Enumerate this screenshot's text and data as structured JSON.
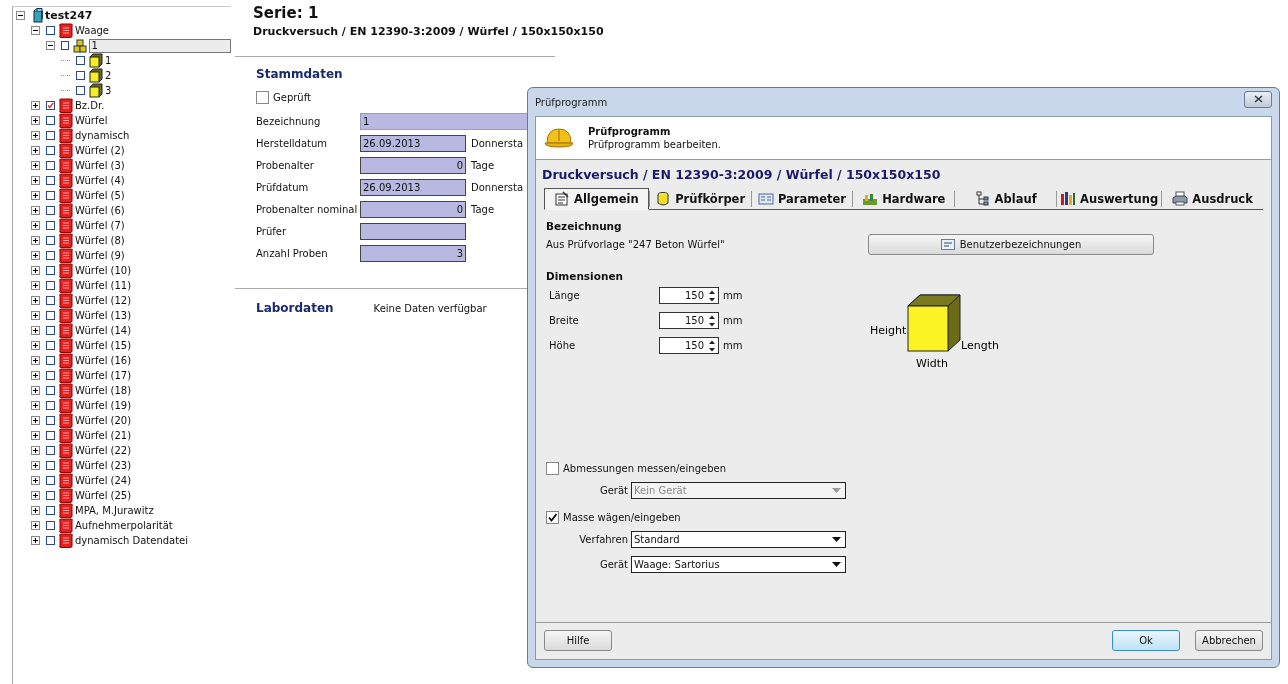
{
  "tree": [
    {
      "label": "test247",
      "kind": "database",
      "expanded": true,
      "children": [
        {
          "label": "Waage",
          "kind": "series",
          "checked": false,
          "expanded": true,
          "children": [
            {
              "label": "1",
              "kind": "group",
              "checked": false,
              "expanded": true,
              "selected": true,
              "children": [
                {
                  "label": "1",
                  "kind": "specimen",
                  "checked": false
                },
                {
                  "label": "2",
                  "kind": "specimen",
                  "checked": false
                },
                {
                  "label": "3",
                  "kind": "specimen",
                  "checked": false
                }
              ]
            }
          ]
        },
        {
          "label": "Bz.Dr.",
          "kind": "series",
          "checked": true,
          "expanded": false
        },
        {
          "label": "Würfel",
          "kind": "series",
          "checked": false,
          "expanded": false
        },
        {
          "label": "dynamisch",
          "kind": "series",
          "checked": false,
          "expanded": false
        },
        {
          "label": "Würfel (2)",
          "kind": "series",
          "checked": false,
          "expanded": false
        },
        {
          "label": "Würfel (3)",
          "kind": "series",
          "checked": false,
          "expanded": false
        },
        {
          "label": "Würfel (4)",
          "kind": "series",
          "checked": false,
          "expanded": false
        },
        {
          "label": "Würfel (5)",
          "kind": "series",
          "checked": false,
          "expanded": false
        },
        {
          "label": "Würfel (6)",
          "kind": "series",
          "checked": false,
          "expanded": false
        },
        {
          "label": "Würfel (7)",
          "kind": "series",
          "checked": false,
          "expanded": false
        },
        {
          "label": "Würfel (8)",
          "kind": "series",
          "checked": false,
          "expanded": false
        },
        {
          "label": "Würfel (9)",
          "kind": "series",
          "checked": false,
          "expanded": false
        },
        {
          "label": "Würfel (10)",
          "kind": "series",
          "checked": false,
          "expanded": false
        },
        {
          "label": "Würfel (11)",
          "kind": "series",
          "checked": false,
          "expanded": false
        },
        {
          "label": "Würfel (12)",
          "kind": "series",
          "checked": false,
          "expanded": false
        },
        {
          "label": "Würfel (13)",
          "kind": "series",
          "checked": false,
          "expanded": false
        },
        {
          "label": "Würfel (14)",
          "kind": "series",
          "checked": false,
          "expanded": false
        },
        {
          "label": "Würfel (15)",
          "kind": "series",
          "checked": false,
          "expanded": false
        },
        {
          "label": "Würfel (16)",
          "kind": "series",
          "checked": false,
          "expanded": false
        },
        {
          "label": "Würfel (17)",
          "kind": "series",
          "checked": false,
          "expanded": false
        },
        {
          "label": "Würfel (18)",
          "kind": "series",
          "checked": false,
          "expanded": false
        },
        {
          "label": "Würfel (19)",
          "kind": "series",
          "checked": false,
          "expanded": false
        },
        {
          "label": "Würfel (20)",
          "kind": "series",
          "checked": false,
          "expanded": false
        },
        {
          "label": "Würfel (21)",
          "kind": "series",
          "checked": false,
          "expanded": false
        },
        {
          "label": "Würfel (22)",
          "kind": "series",
          "checked": false,
          "expanded": false
        },
        {
          "label": "Würfel (23)",
          "kind": "series",
          "checked": false,
          "expanded": false
        },
        {
          "label": "Würfel (24)",
          "kind": "series",
          "checked": false,
          "expanded": false
        },
        {
          "label": "Würfel (25)",
          "kind": "series",
          "checked": false,
          "expanded": false
        },
        {
          "label": "MPA, M.Jurawitz",
          "kind": "series",
          "checked": false,
          "expanded": false
        },
        {
          "label": "Aufnehmerpolarität",
          "kind": "series",
          "checked": false,
          "expanded": false
        },
        {
          "label": "dynamisch Datendatei",
          "kind": "series",
          "checked": false,
          "expanded": false
        }
      ]
    }
  ],
  "series": {
    "title": "Serie:  1",
    "subtitle": "Druckversuch / EN 12390-3:2009 / Würfel / 150x150x150",
    "master_heading": "Stammdaten",
    "checked_label": "Geprüft",
    "checked": false,
    "fields": [
      {
        "label": "Bezeichnung",
        "value": "1",
        "kind": "text"
      },
      {
        "label": "Herstelldatum",
        "value": "26.09.2013",
        "kind": "date",
        "suffix": "Donnersta"
      },
      {
        "label": "Probenalter",
        "value": "0",
        "kind": "number",
        "suffix": "Tage"
      },
      {
        "label": "Prüfdatum",
        "value": "26.09.2013",
        "kind": "date",
        "suffix": "Donnersta"
      },
      {
        "label": "Probenalter nominal",
        "value": "0",
        "kind": "number",
        "suffix": "Tage"
      },
      {
        "label": "Prüfer",
        "kind": "date"
      },
      {
        "label": "Anzahl Proben",
        "value": "3",
        "kind": "number"
      }
    ],
    "lab_heading": "Labordaten",
    "lab_text": "Keine Daten verfügbar"
  },
  "dialog": {
    "title": "Prüfprogramm",
    "header_title": "Prüfprogramm",
    "header_text": "Prüfprogramm bearbeiten.",
    "path": "Druckversuch / EN 12390-3:2009 / Würfel / 150x150x150",
    "tabs": [
      {
        "label": "Allgemein",
        "selected": true
      },
      {
        "label": "Prüfkörper",
        "selected": false
      },
      {
        "label": "Parameter",
        "selected": false
      },
      {
        "label": "Hardware",
        "selected": false
      },
      {
        "label": "Ablauf",
        "selected": false
      },
      {
        "label": "Auswertung",
        "selected": false
      },
      {
        "label": "Ausdruck",
        "selected": false
      }
    ],
    "name_heading": "Bezeichnung",
    "name_text": "Aus Prüfvorlage \"247 Beton Würfel\"",
    "names_button": "Benutzerbezeichnungen",
    "dims_heading": "Dimensionen",
    "dims": [
      {
        "label": "Länge",
        "value": "150",
        "unit": "mm"
      },
      {
        "label": "Breite",
        "value": "150",
        "unit": "mm"
      },
      {
        "label": "Höhe",
        "value": "150",
        "unit": "mm"
      }
    ],
    "cube_labels": {
      "height": "Height",
      "length": "Length",
      "width": "Width"
    },
    "options": [
      {
        "label": "Abmessungen messen/eingeben",
        "checked": false,
        "selects": [
          {
            "label": "Gerät",
            "value": "Kein Gerät",
            "disabled": true
          }
        ]
      },
      {
        "label": "Masse wägen/eingeben",
        "checked": true,
        "selects": [
          {
            "label": "Verfahren",
            "value": "Standard",
            "disabled": false
          },
          {
            "label": "Gerät",
            "value": "Waage: Sartorius",
            "disabled": false
          }
        ]
      }
    ],
    "buttons": [
      {
        "label": "Hilfe",
        "default": false
      },
      {
        "label": "Ok",
        "default": true
      },
      {
        "label": "Abbrechen",
        "default": false
      }
    ]
  }
}
